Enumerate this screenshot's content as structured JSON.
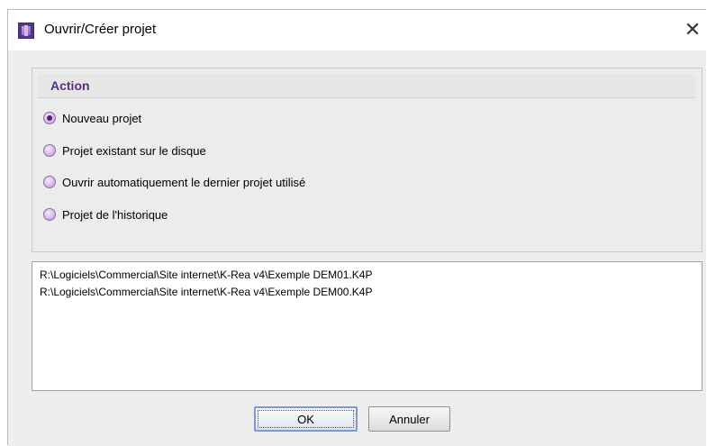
{
  "window": {
    "title": "Ouvrir/Créer projet",
    "close_glyph": "✕",
    "app_icon": "kmp-app-icon"
  },
  "action": {
    "title": "Action",
    "options": [
      {
        "label": "Nouveau projet",
        "checked": true
      },
      {
        "label": "Projet existant sur le disque",
        "checked": false
      },
      {
        "label": "Ouvrir automatiquement le dernier projet utilisé",
        "checked": false
      },
      {
        "label": "Projet de l'historique",
        "checked": false
      }
    ]
  },
  "history": {
    "items": [
      "R:\\Logiciels\\Commercial\\Site internet\\K-Rea v4\\Exemple DEM01.K4P",
      "R:\\Logiciels\\Commercial\\Site internet\\K-Rea v4\\Exemple DEM00.K4P"
    ]
  },
  "buttons": {
    "ok_label": "OK",
    "cancel_label": "Annuler"
  },
  "colors": {
    "accent": "#5a2d82",
    "window_bg": "#eeeeee",
    "focus_border": "#7a9cd6"
  }
}
